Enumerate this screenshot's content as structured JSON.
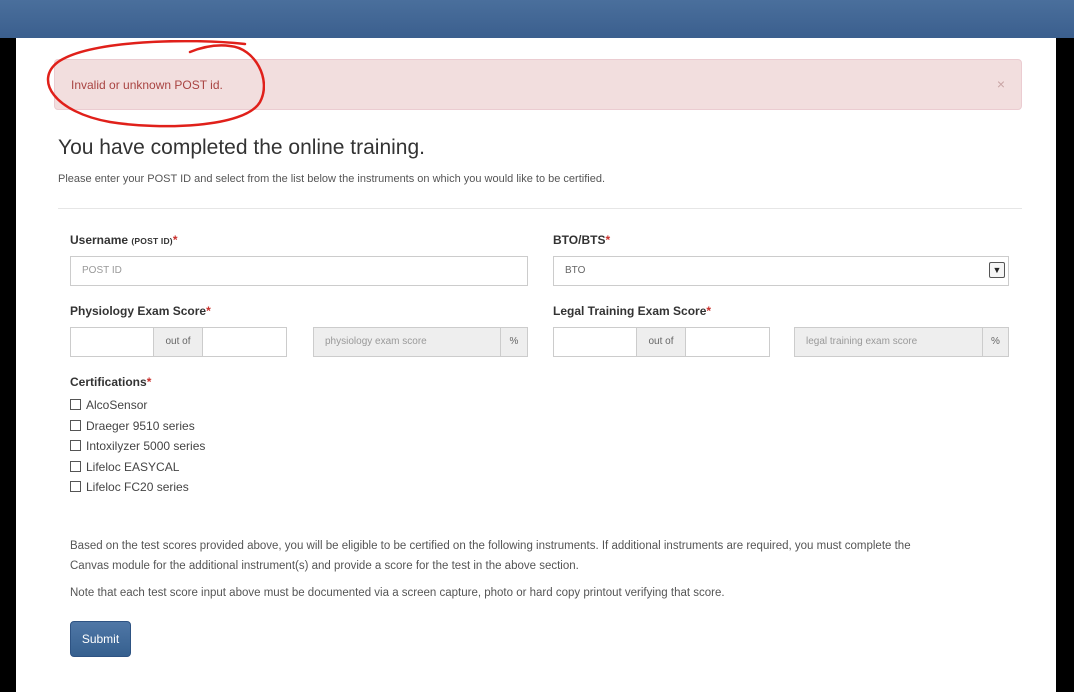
{
  "alert": {
    "message": "Invalid or unknown POST id.",
    "close": "×"
  },
  "page": {
    "title": "You have completed the online training.",
    "subtitle": "Please enter your POST ID and select from the list below the instruments on which you would like to be certified."
  },
  "form": {
    "username": {
      "label": "Username",
      "label_small": "(POST ID)",
      "required": "*",
      "placeholder": "POST ID"
    },
    "bto_bts": {
      "label": "BTO/BTS",
      "required": "*",
      "value": "BTO"
    },
    "physiology": {
      "label": "Physiology Exam Score",
      "required": "*",
      "out_of": "out of",
      "score_placeholder": "physiology exam score",
      "unit": "%"
    },
    "legal": {
      "label": "Legal Training Exam Score",
      "required": "*",
      "out_of": "out of",
      "score_placeholder": "legal training exam score",
      "unit": "%"
    },
    "certifications": {
      "label": "Certifications",
      "required": "*",
      "items": [
        "AlcoSensor",
        "Draeger 9510 series",
        "Intoxilyzer 5000 series",
        "Lifeloc EASYCAL",
        "Lifeloc FC20 series"
      ]
    }
  },
  "info": {
    "line1": "Based on the test scores provided above, you will be eligible to be certified on the following instruments. If additional instruments are required, you must complete the",
    "line2": "Canvas module for the additional instrument(s) and provide a score for the test in the above section.",
    "note": "Note that each test score input above must be documented via a screen capture, photo or hard copy printout verifying that score."
  },
  "submit_label": "Submit",
  "colors": {
    "topbar": "#3b5f8e",
    "alert_bg": "#f2dede",
    "alert_text": "#a94442",
    "required": "#c9302c",
    "button": "#36608f",
    "annotation": "#e0201a"
  }
}
